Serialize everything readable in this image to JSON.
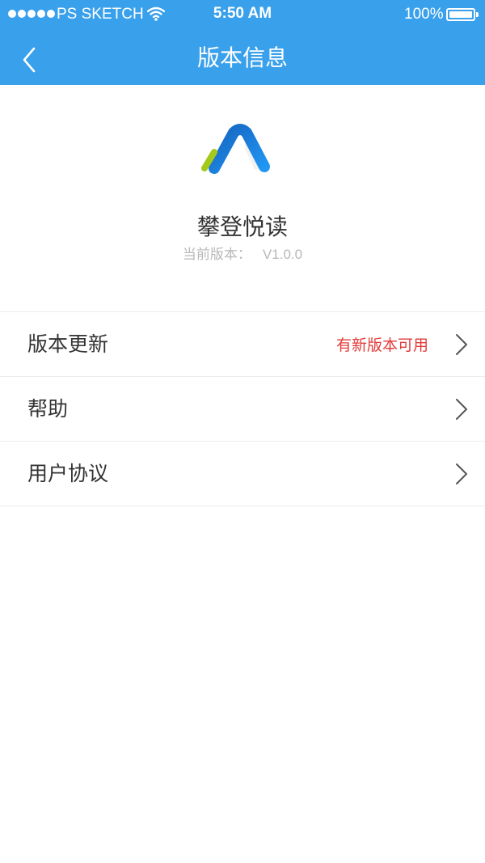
{
  "status_bar": {
    "carrier": "PS SKETCH",
    "time": "5:50 AM",
    "battery": "100%"
  },
  "nav": {
    "title": "版本信息",
    "back_icon": "chevron-left-icon"
  },
  "app": {
    "name": "攀登悦读",
    "version_label": "当前版本：",
    "version_value": "V1.0.0"
  },
  "menu": {
    "items": [
      {
        "label": "版本更新",
        "status": "有新版本可用",
        "icon": "chevron-right-icon"
      },
      {
        "label": "帮助",
        "icon": "chevron-right-icon"
      },
      {
        "label": "用户协议",
        "icon": "chevron-right-icon"
      }
    ]
  },
  "colors": {
    "header": "#39a0ec",
    "accent_red": "#e23b3b",
    "logo_blue": "#1e88e5",
    "logo_green": "#a4c91b"
  }
}
